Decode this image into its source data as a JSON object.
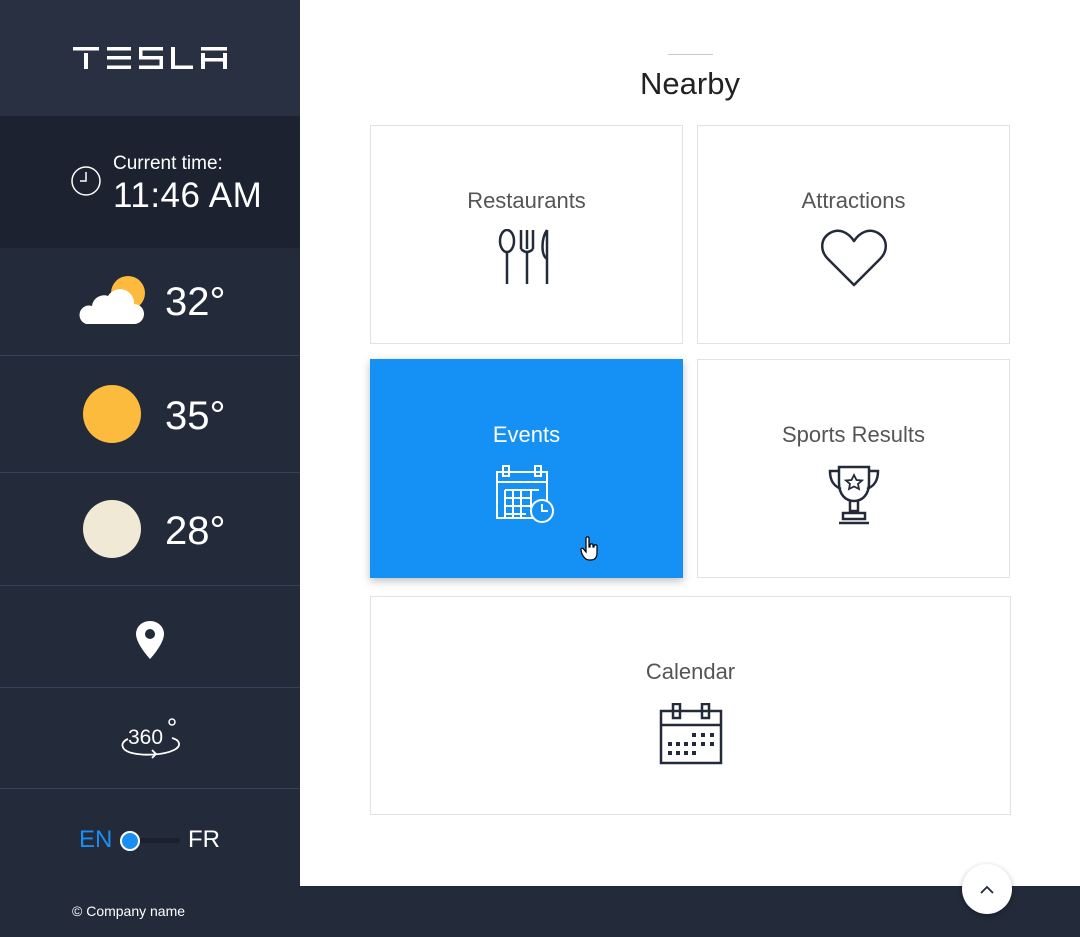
{
  "brand": {
    "logo_text": "TESLA"
  },
  "sidebar": {
    "time_label": "Current time:",
    "time_value": "11:46 AM",
    "weather": [
      {
        "icon": "cloud-sun-icon",
        "temp": "32°"
      },
      {
        "icon": "sun-icon",
        "temp": "35°"
      },
      {
        "icon": "moon-icon",
        "temp": "28°"
      }
    ],
    "location_icon": "map-pin-icon",
    "view360_icon": "360-view-icon",
    "language": {
      "left": "EN",
      "right": "FR",
      "selected": "EN"
    }
  },
  "main": {
    "title": "Nearby",
    "cards": [
      {
        "label": "Restaurants",
        "icon": "cutlery-icon"
      },
      {
        "label": "Attractions",
        "icon": "heart-icon"
      },
      {
        "label": "Events",
        "icon": "calendar-clock-icon",
        "active": true
      },
      {
        "label": "Sports Results",
        "icon": "trophy-icon"
      },
      {
        "label": "Calendar",
        "icon": "calendar-icon"
      }
    ]
  },
  "footer": {
    "copyright": "© Company name"
  },
  "colors": {
    "sidebar": "#232a3a",
    "accent": "#1590f5",
    "sun": "#fdbb3d",
    "moon": "#f0e9d6"
  }
}
